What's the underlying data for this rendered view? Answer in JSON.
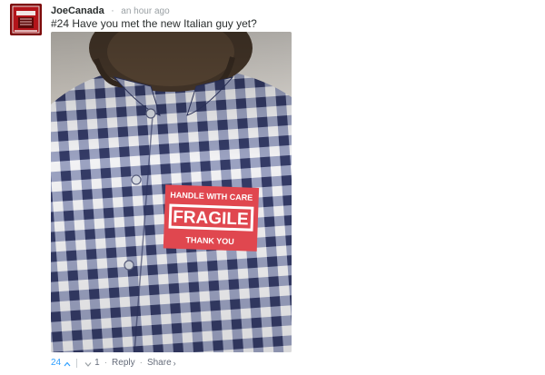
{
  "comment": {
    "author": "JoeCanada",
    "separator": "·",
    "timestamp": "an hour ago",
    "message": "#24 Have you met the new Italian guy yet?",
    "photo": {
      "label_top": "HANDLE WITH CARE",
      "label_main": "FRAGILE",
      "label_bottom": "THANK YOU"
    },
    "footer": {
      "upvotes": "24",
      "downvotes": "1",
      "reply_label": "Reply",
      "share_label": "Share",
      "share_chevron": "›",
      "dot": "·"
    }
  },
  "colors": {
    "accent": "#2e9fff",
    "label_red": "#e0474f",
    "shirt_navy": "#3a4270"
  },
  "icons": {
    "upvote": "chevron-up-icon",
    "downvote": "chevron-down-icon",
    "share": "chevron-right-icon"
  }
}
